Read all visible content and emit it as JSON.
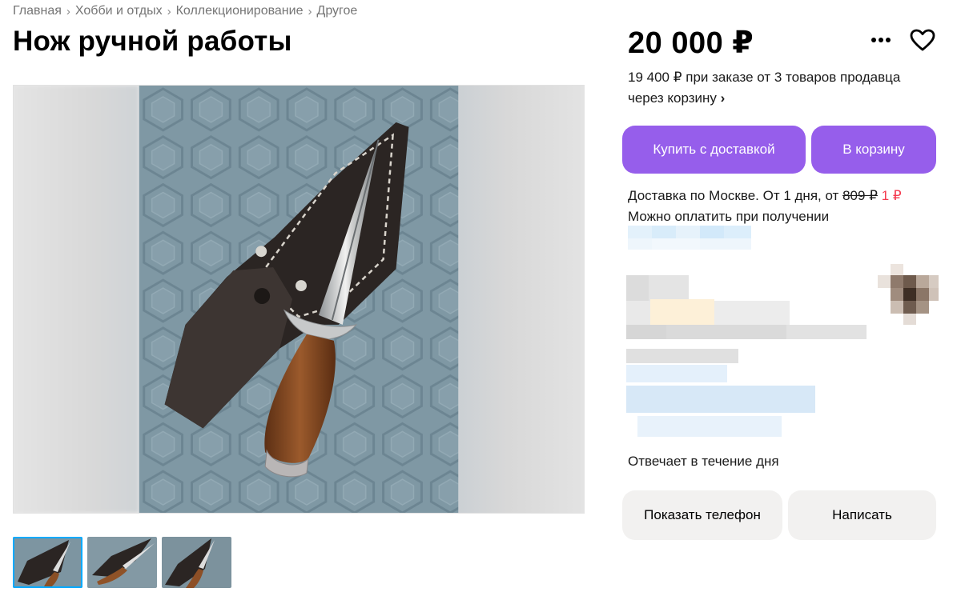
{
  "breadcrumb": {
    "items": [
      "Главная",
      "Хобби и отдых",
      "Коллекционирование",
      "Другое"
    ],
    "separator": "›"
  },
  "listing": {
    "title": "Нож ручной работы",
    "price": "20 000 ₽",
    "bulk_price_line1": "19 400 ₽ при заказе от 3 товаров продавца",
    "bulk_price_line2": "через корзину",
    "bulk_chevron": "›"
  },
  "actions": {
    "buy_label": "Купить с доставкой",
    "cart_label": "В корзину",
    "phone_label": "Показать телефон",
    "write_label": "Написать",
    "more_icon": "more-dots-icon",
    "favorite_icon": "heart-icon"
  },
  "delivery": {
    "text_prefix": "Доставка по Москве. От 1 дня, от ",
    "old_price": "809 ₽",
    "new_price": "1 ₽",
    "payment_note": "Можно оплатить при получении"
  },
  "seller": {
    "response_time": "Отвечает в течение дня"
  },
  "colors": {
    "accent": "#965eeb",
    "discount": "#f4394e",
    "thumb_active": "#00aaff",
    "secondary_button": "#f2f1f0"
  },
  "gallery": {
    "thumbnail_count": 3,
    "active_thumbnail": 1
  }
}
